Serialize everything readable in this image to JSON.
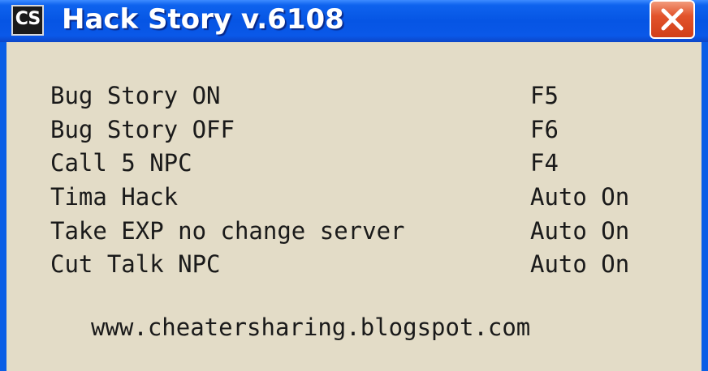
{
  "window": {
    "app_icon_text": "CS",
    "title": "Hack Story v.6108",
    "close_icon": "close-x-icon"
  },
  "hotkeys": [
    {
      "label": "Bug Story ON",
      "key": "F5"
    },
    {
      "label": "Bug Story OFF",
      "key": "F6"
    },
    {
      "label": "Call 5 NPC",
      "key": "F4"
    },
    {
      "label": "Tima Hack",
      "key": "Auto On"
    },
    {
      "label": "Take EXP no change server",
      "key": "Auto On"
    },
    {
      "label": "Cut Talk NPC",
      "key": "Auto On"
    }
  ],
  "footer": {
    "url": "www.cheatersharing.blogspot.com"
  },
  "colors": {
    "titlebar": "#0655e4",
    "client_bg": "#e3dcc7",
    "close_button": "#d13f18",
    "text": "#1a1a1a"
  }
}
